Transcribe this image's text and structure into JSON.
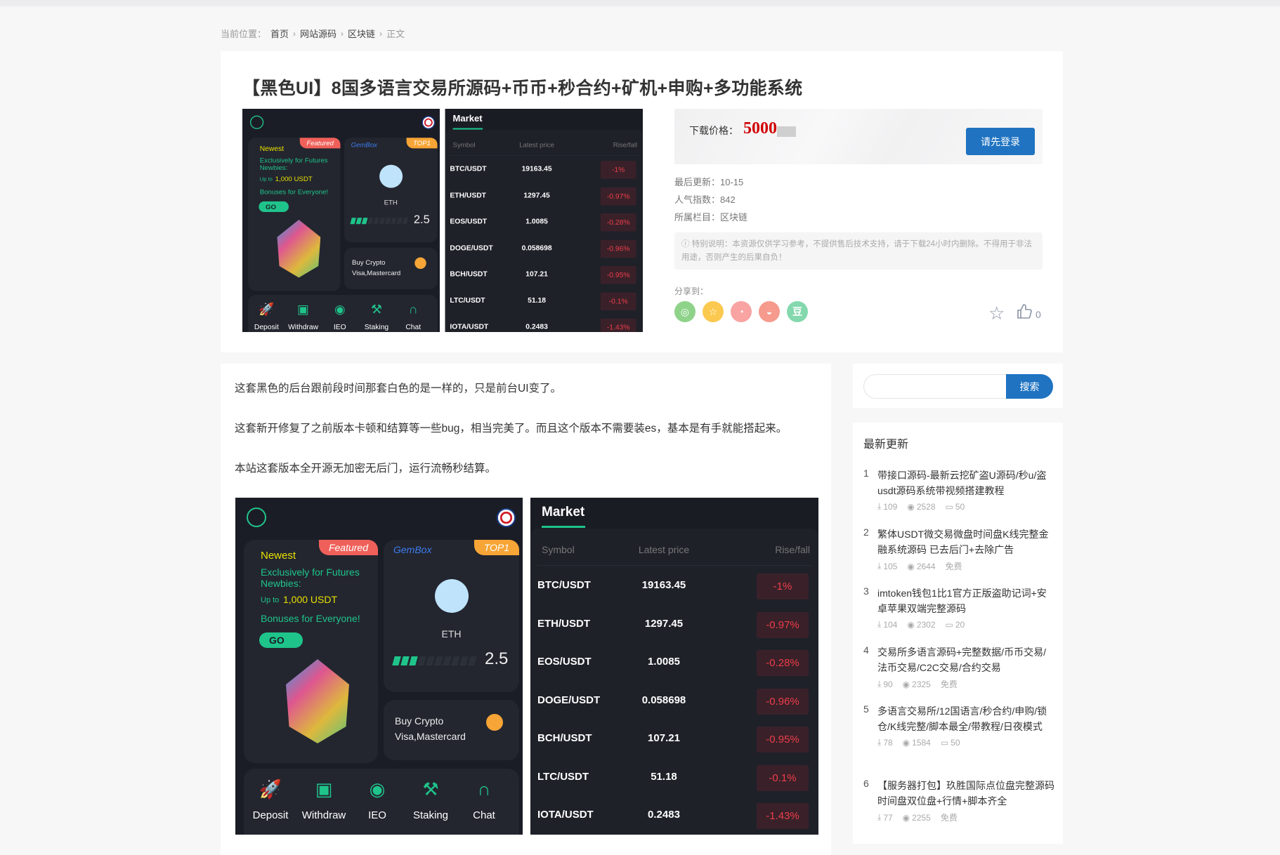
{
  "breadcrumb": {
    "prefix": "当前位置：",
    "items": [
      "首页",
      "网站源码",
      "区块链"
    ],
    "current": "正文"
  },
  "article": {
    "title": "【黑色UI】8国多语言交易所源码+币币+秒合约+矿机+申购+多功能系统",
    "price_label": "下载价格：",
    "price": "5000",
    "login_button": "请先登录",
    "meta": [
      {
        "label": "最后更新：",
        "value": "10-15"
      },
      {
        "label": "人气指数：",
        "value": "842"
      },
      {
        "label": "所属栏目：",
        "value": "区块链"
      }
    ],
    "notice": "特别说明：本资源仅供学习参考，不提供售后技术支持，请于下载24小时内删除。不得用于非法用途，否则产生的后果自负！",
    "share_label": "分享到：",
    "share_icons": [
      {
        "icon": "wechat-icon",
        "color": "#8fd38a"
      },
      {
        "icon": "qzone-icon",
        "color": "#fbc94f"
      },
      {
        "icon": "weibo-icon",
        "color": "#f9a3a3"
      },
      {
        "icon": "qq-icon",
        "color": "#f59a8d"
      },
      {
        "icon": "douban-icon",
        "color": "#84d8ad"
      }
    ],
    "like_count": "0",
    "paragraphs": [
      "这套黑色的后台跟前段时间那套白色的是一样的，只是前台UI变了。",
      "这套新开修复了之前版本卡顿和结算等一些bug，相当完美了。而且这个版本不需要装es，基本是有手就能搭起来。",
      "本站这套版本全开源无加密无后门，运行流畅秒结算。"
    ]
  },
  "mock": {
    "featured": "Featured",
    "newest": "Newest",
    "exclusive": "Exclusively for Futures Newbies:",
    "upto": "Up to",
    "amount": "1,000 USDT",
    "bonus": "Bonuses for Everyone!",
    "go": "GO",
    "gembox": "GemBox",
    "top1": "TOP1",
    "coin": "ETH",
    "score": "2.5",
    "score_fill": 0.3,
    "buy1": "Buy Crypto",
    "buy2": "Visa,Mastercard",
    "nav": [
      "Deposit",
      "Withdraw",
      "IEO",
      "Staking",
      "Chat"
    ],
    "market_title": "Market",
    "cols": [
      "Symbol",
      "Latest price",
      "Rise/fall"
    ],
    "rows": [
      [
        "BTC/USDT",
        "19163.45",
        "-1%"
      ],
      [
        "ETH/USDT",
        "1297.45",
        "-0.97%"
      ],
      [
        "EOS/USDT",
        "1.0085",
        "-0.28%"
      ],
      [
        "DOGE/USDT",
        "0.058698",
        "-0.96%"
      ],
      [
        "BCH/USDT",
        "107.21",
        "-0.95%"
      ],
      [
        "LTC/USDT",
        "51.18",
        "-0.1%"
      ],
      [
        "IOTA/USDT",
        "0.2483",
        "-1.43%"
      ]
    ],
    "accent": "#1fc48b",
    "down_color": "#ee3d4a"
  },
  "sidebar": {
    "search_button": "搜索",
    "search_placeholder": "",
    "latest_title": "最新更新",
    "items": [
      {
        "n": "1",
        "title": "带接口源码-最新云挖矿盗U源码/秒u/盗usdt源码系统带视频搭建教程",
        "downloads": "109",
        "views": "2528",
        "price": "50"
      },
      {
        "n": "2",
        "title": "繁体USDT微交易微盘时间盘K线完整金融系统源码 已去后门+去除广告",
        "downloads": "105",
        "views": "2644",
        "price": "免费"
      },
      {
        "n": "3",
        "title": "imtoken钱包1比1官方正版盗助记词+安卓苹果双端完整源码",
        "downloads": "104",
        "views": "2302",
        "price": "20"
      },
      {
        "n": "4",
        "title": "交易所多语言源码+完整数据/币币交易/法币交易/C2C交易/合约交易",
        "downloads": "90",
        "views": "2325",
        "price": "免费"
      },
      {
        "n": "5",
        "title": "多语言交易所/12国语言/秒合约/申购/锁仓/K线完整/脚本最全/带教程/日夜模式",
        "downloads": "78",
        "views": "1584",
        "price": "50"
      },
      {
        "n": "6",
        "title": "【服务器打包】玖胜国际点位盘完整源码 时间盘双位盘+行情+脚本齐全",
        "downloads": "77",
        "views": "2255",
        "price": "免费"
      }
    ]
  }
}
